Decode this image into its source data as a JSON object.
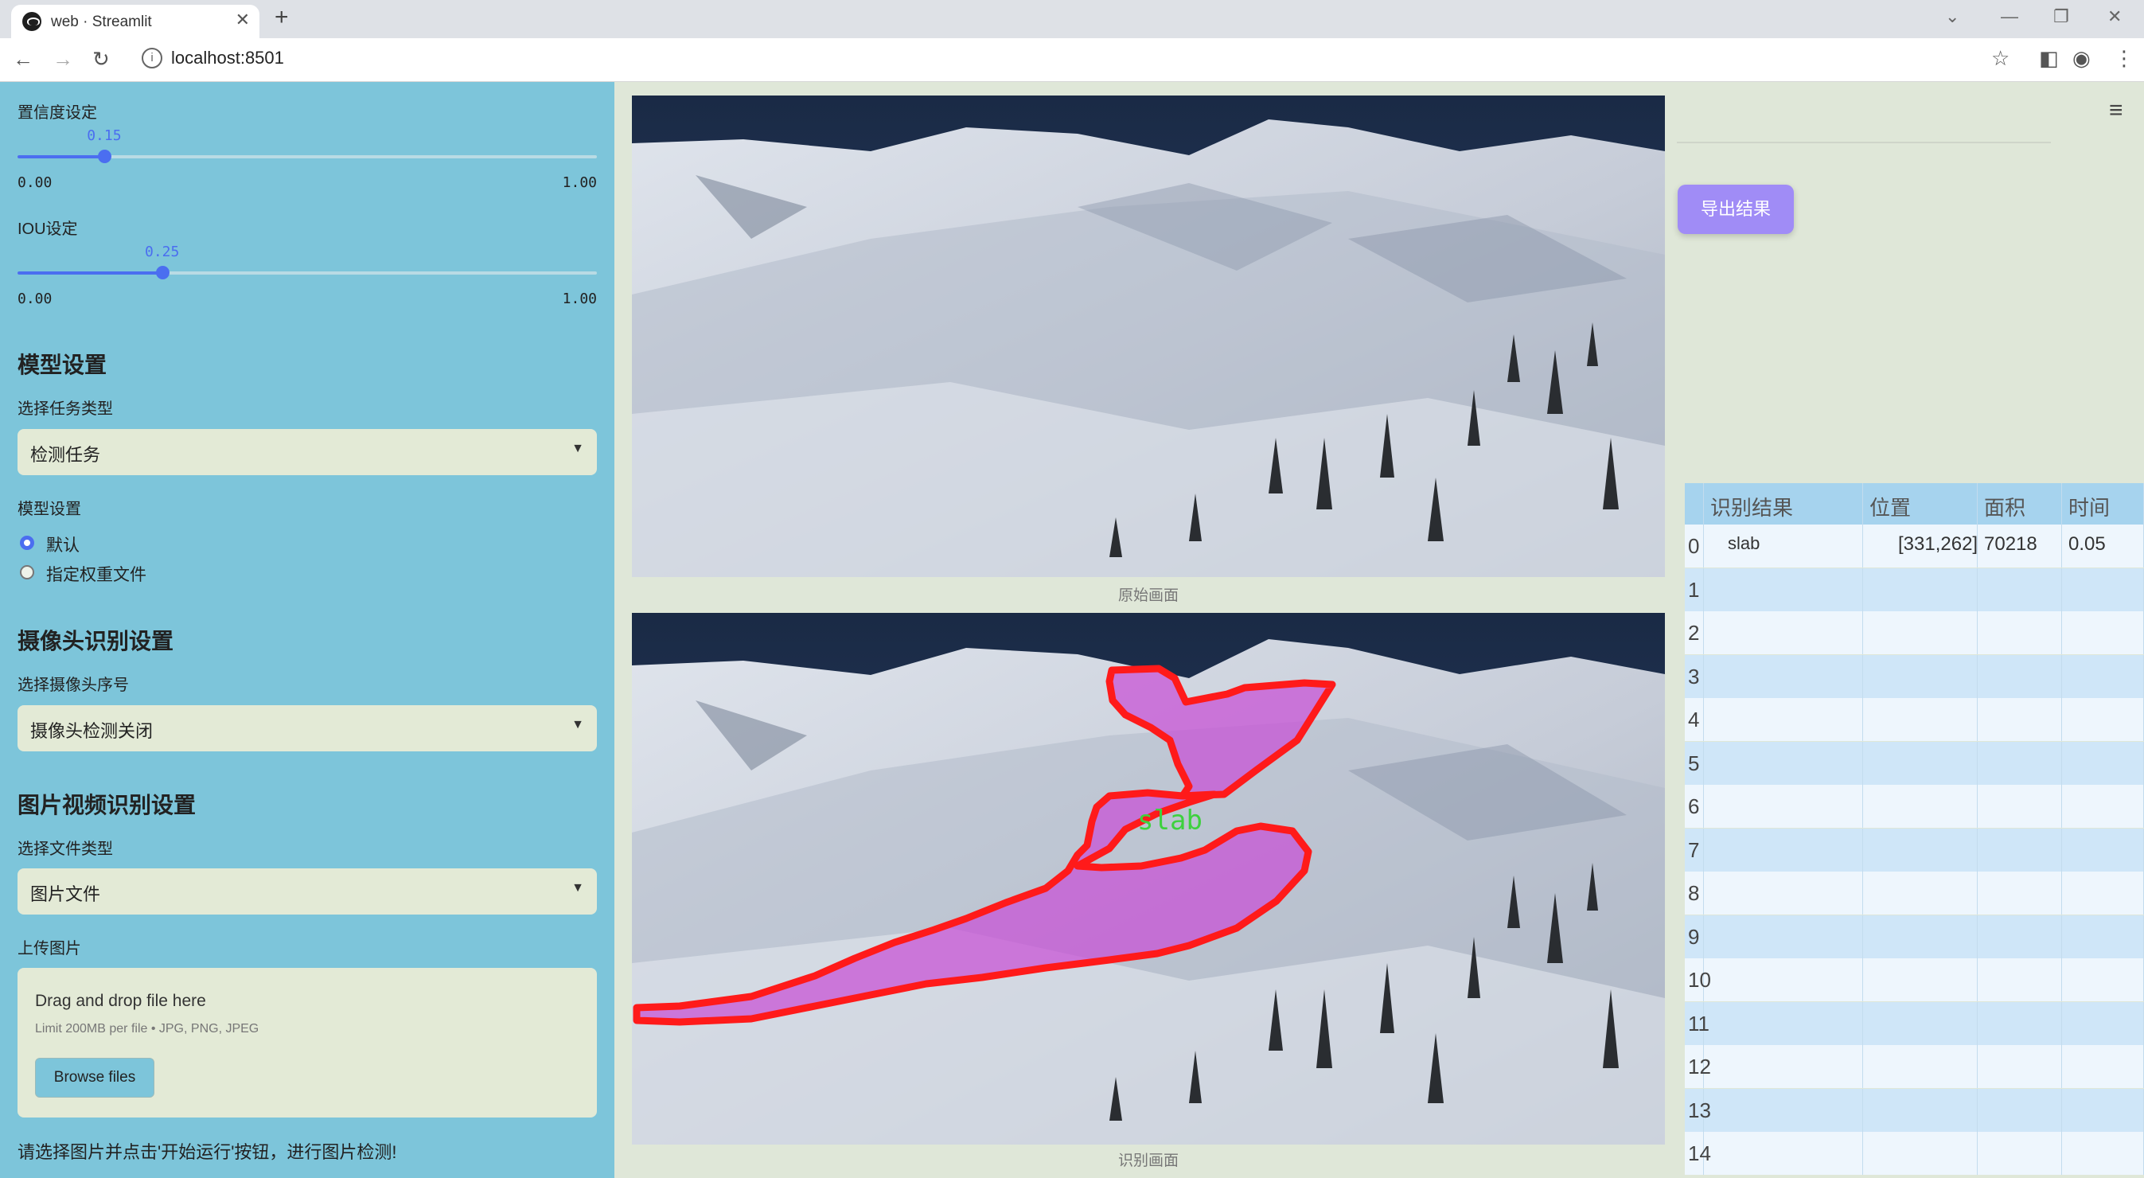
{
  "browser": {
    "tab_title": "web · Streamlit",
    "url": "localhost:8501"
  },
  "sidebar": {
    "confidence": {
      "label": "置信度设定",
      "value_text": "0.15",
      "value": 0.15,
      "min": "0.00",
      "max": "1.00"
    },
    "iou": {
      "label": "IOU设定",
      "value_text": "0.25",
      "value": 0.25,
      "min": "0.00",
      "max": "1.00"
    },
    "model_section": {
      "title": "模型设置",
      "task_label": "选择任务类型",
      "task_value": "检测任务",
      "model_label": "模型设置",
      "options": [
        "默认",
        "指定权重文件"
      ],
      "selected_option": 0
    },
    "camera_section": {
      "title": "摄像头识别设置",
      "camera_label": "选择摄像头序号",
      "camera_value": "摄像头检测关闭"
    },
    "media_section": {
      "title": "图片视频识别设置",
      "file_type_label": "选择文件类型",
      "file_type_value": "图片文件",
      "upload_label": "上传图片",
      "drop_title": "Drag and drop file here",
      "drop_limit": "Limit 200MB per file • JPG, PNG, JPEG",
      "browse_label": "Browse files"
    },
    "hint": "请选择图片并点击'开始运行'按钮，进行图片检测!"
  },
  "main": {
    "original_caption": "原始画面",
    "result_caption": "识别画面",
    "detection_label": "slab",
    "export_label": "导出结果"
  },
  "results_table": {
    "columns": [
      "识别结果",
      "位置",
      "面积",
      "时间"
    ],
    "rows": [
      {
        "index": "0",
        "cells": [
          "slab",
          "[331,262]",
          "70218",
          "0.05"
        ]
      },
      {
        "index": "1",
        "cells": [
          "",
          "",
          "",
          ""
        ]
      },
      {
        "index": "2",
        "cells": [
          "",
          "",
          "",
          ""
        ]
      },
      {
        "index": "3",
        "cells": [
          "",
          "",
          "",
          ""
        ]
      },
      {
        "index": "4",
        "cells": [
          "",
          "",
          "",
          ""
        ]
      },
      {
        "index": "5",
        "cells": [
          "",
          "",
          "",
          ""
        ]
      },
      {
        "index": "6",
        "cells": [
          "",
          "",
          "",
          ""
        ]
      },
      {
        "index": "7",
        "cells": [
          "",
          "",
          "",
          ""
        ]
      },
      {
        "index": "8",
        "cells": [
          "",
          "",
          "",
          ""
        ]
      },
      {
        "index": "9",
        "cells": [
          "",
          "",
          "",
          ""
        ]
      },
      {
        "index": "10",
        "cells": [
          "",
          "",
          "",
          ""
        ]
      },
      {
        "index": "11",
        "cells": [
          "",
          "",
          "",
          ""
        ]
      },
      {
        "index": "12",
        "cells": [
          "",
          "",
          "",
          ""
        ]
      },
      {
        "index": "13",
        "cells": [
          "",
          "",
          "",
          ""
        ]
      },
      {
        "index": "14",
        "cells": [
          "",
          "",
          "",
          ""
        ]
      }
    ]
  },
  "colors": {
    "sidebar_bg": "#7dc5da",
    "accent": "#4b6ef0",
    "export_button": "#a08cf6",
    "mask_fill": "#c84fd6",
    "mask_outline": "#ff1a1a",
    "label_green": "#3ed13e"
  }
}
